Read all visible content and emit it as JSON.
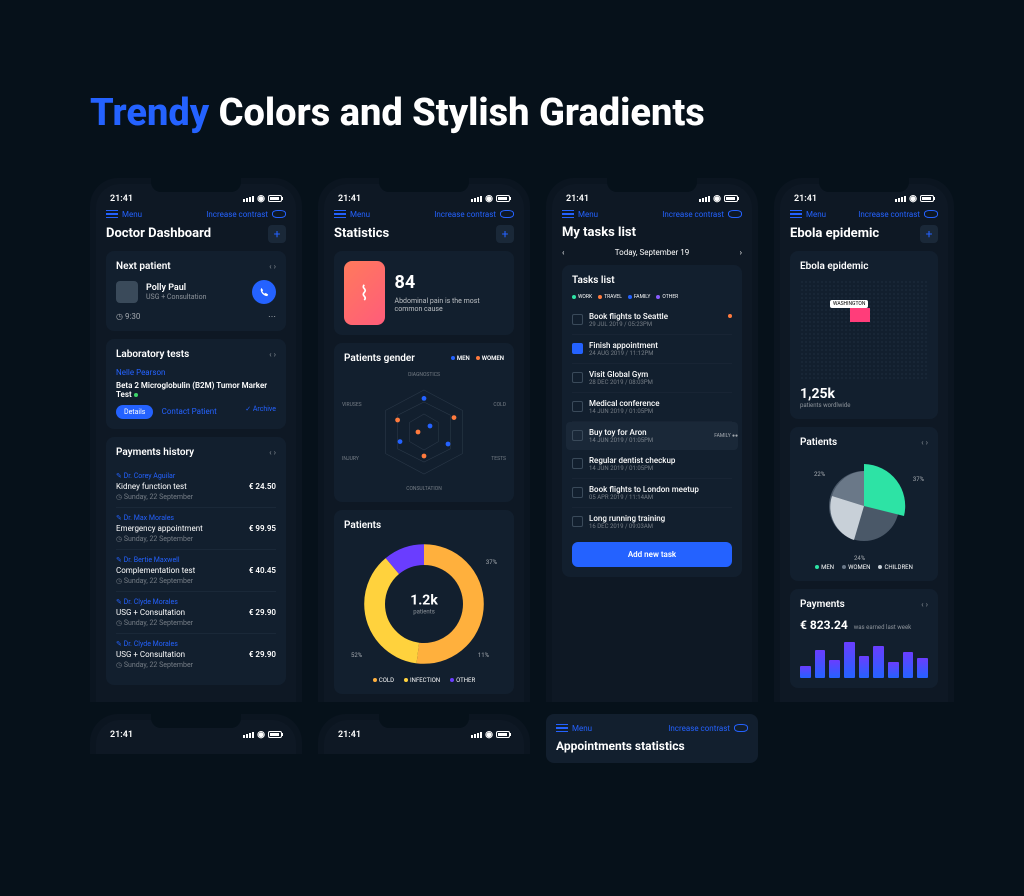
{
  "hero": {
    "accent": "Trendy",
    "rest": "Colors and Stylish Gradients"
  },
  "status_time": "21:41",
  "menu": "Menu",
  "contrast": "Increase contrast",
  "p1": {
    "title": "Doctor Dashboard",
    "next_h": "Next patient",
    "patient": "Polly Paul",
    "service": "USG + Consultation",
    "time": "9:30",
    "lab_h": "Laboratory tests",
    "lab_link": "Nelle Pearson",
    "lab_test": "Beta 2 Microglobulin (B2M) Tumor Marker Test",
    "details": "Details",
    "contact": "Contact Patient",
    "archive": "✓ Archive",
    "pay_h": "Payments history",
    "payments": [
      {
        "doc": "Dr. Corey Aguilar",
        "desc": "Kidney function test",
        "date": "Sunday, 22 September",
        "amt": "€  24.50"
      },
      {
        "doc": "Dr. Max Morales",
        "desc": "Emergency appointment",
        "date": "Sunday, 22 September",
        "amt": "€  99.95"
      },
      {
        "doc": "Dr. Bertie Maxwell",
        "desc": "Complementation test",
        "date": "Sunday, 22 September",
        "amt": "€  40.45"
      },
      {
        "doc": "Dr. Clyde Morales",
        "desc": "USG + Consultation",
        "date": "Sunday, 22 September",
        "amt": "€  29.90"
      },
      {
        "doc": "Dr. Clyde Morales",
        "desc": "USG + Consultation",
        "date": "Sunday, 22 September",
        "amt": "€  29.90"
      }
    ]
  },
  "p2": {
    "title": "Statistics",
    "stat_num": "84",
    "stat_desc": "Abdominal pain is the most common cause",
    "gender_h": "Patients gender",
    "men": "MEN",
    "women": "WOMEN",
    "radar_labels": [
      "DIAGNOSTICS",
      "COLD",
      "TESTS",
      "CONSULTATION",
      "INJURY",
      "VIRUSES"
    ],
    "patients_h": "Patients",
    "donut_n": "1.2k",
    "donut_l": "patients",
    "donut_pcts": [
      "37%",
      "11%",
      "52%"
    ],
    "legend2": [
      "COLD",
      "INFECTION",
      "OTHER"
    ]
  },
  "p3": {
    "title": "My tasks list",
    "date": "Today, September 19",
    "list_h": "Tasks list",
    "tags": [
      "WORK",
      "TRAVEL",
      "FAMILY",
      "OTHER"
    ],
    "tag_colors": [
      "#2de3a5",
      "#ff7a3d",
      "#2462ff",
      "#8a5cff"
    ],
    "tasks": [
      {
        "t": "Book flights to Seattle",
        "d": "29 JUL 2019  /  05:23PM",
        "chk": false,
        "dot": "#ff7a3d"
      },
      {
        "t": "Finish appointment",
        "d": "24 AUG 2019  /  11:12PM",
        "chk": true,
        "dot": ""
      },
      {
        "t": "Visit Global Gym",
        "d": "28 DEC 2019  /  08:03PM",
        "chk": false,
        "dot": ""
      },
      {
        "t": "Medical conference",
        "d": "14 JUN 2019  /  01:05PM",
        "chk": false,
        "dot": ""
      },
      {
        "t": "Buy toy for Aron",
        "d": "14 JUN 2019  /  01:05PM",
        "chk": false,
        "sel": true,
        "tag": "FAMILY"
      },
      {
        "t": "Regular dentist checkup",
        "d": "14 JUN 2019  /  01:05PM",
        "chk": false,
        "dot": ""
      },
      {
        "t": "Book flights to London meetup",
        "d": "05 APR 2019  /  11:14AM",
        "chk": false,
        "dot": ""
      },
      {
        "t": "Long running training",
        "d": "16 DEC 2019  /  09:03AM",
        "chk": false,
        "dot": ""
      }
    ],
    "add": "Add new task"
  },
  "p4": {
    "title": "Ebola epidemic",
    "map_h": "Ebola epidemic",
    "map_label": "WASHINGTON",
    "big": "1,25k",
    "bigsub": "patients wordlwide",
    "pat_h": "Patients",
    "pcts": [
      "22%",
      "37%",
      "24%"
    ],
    "leg": [
      "MEN",
      "WOMEN",
      "CHILDREN"
    ],
    "pay_h": "Payments",
    "earned": "€ 823.24",
    "earned_sub": "was earned last week",
    "bars": [
      30,
      70,
      45,
      90,
      55,
      80,
      40,
      65,
      50
    ]
  },
  "p5": {
    "title": "Appointments statistics"
  },
  "chart_data": [
    {
      "type": "pie",
      "title": "Patients (donut)",
      "categories": [
        "Cold",
        "Infection",
        "Other"
      ],
      "values": [
        52,
        11,
        37
      ],
      "total_label": "1.2k patients"
    },
    {
      "type": "pie",
      "title": "Ebola Patients",
      "categories": [
        "Men",
        "Women",
        "Children"
      ],
      "values": [
        22,
        24,
        37
      ]
    },
    {
      "type": "bar",
      "title": "Payments weekly",
      "categories": [
        "1",
        "2",
        "3",
        "4",
        "5",
        "6",
        "7",
        "8",
        "9"
      ],
      "values": [
        30,
        70,
        45,
        90,
        55,
        80,
        40,
        65,
        50
      ],
      "ylabel": "€"
    }
  ]
}
